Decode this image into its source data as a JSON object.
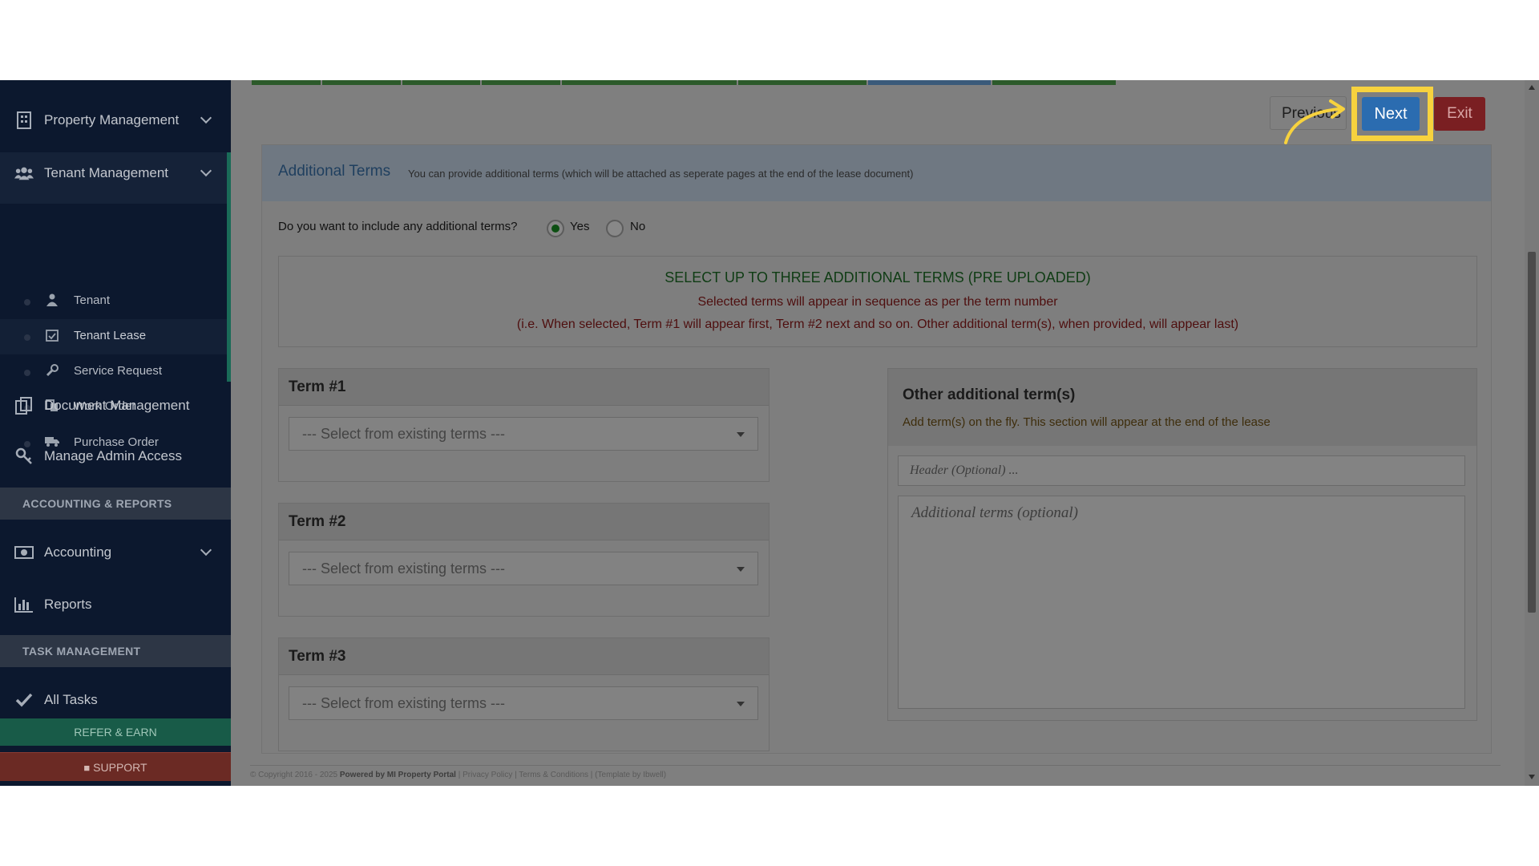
{
  "sidebar": {
    "items": [
      {
        "label": "Property Management",
        "icon": "building-icon"
      },
      {
        "label": "Tenant Management",
        "icon": "users-icon"
      },
      {
        "label": "Document Management",
        "icon": "documents-icon"
      },
      {
        "label": "Manage Admin Access",
        "icon": "key-icon"
      },
      {
        "label": "Accounting",
        "icon": "money-icon"
      },
      {
        "label": "Reports",
        "icon": "bar-chart-icon"
      },
      {
        "label": "All Tasks",
        "icon": "check-icon"
      }
    ],
    "sub_items": [
      {
        "label": "Tenant",
        "icon": "user-icon"
      },
      {
        "label": "Tenant Lease",
        "icon": "calendar-check-icon"
      },
      {
        "label": "Service Request",
        "icon": "wrench-icon"
      },
      {
        "label": "Work Order",
        "icon": "copy-icon"
      },
      {
        "label": "Purchase Order",
        "icon": "truck-icon"
      }
    ],
    "sections": {
      "accounting": "ACCOUNTING & REPORTS",
      "tasks": "TASK MANAGEMENT"
    },
    "refer_label": "REFER & EARN",
    "support_label": "SUPPORT"
  },
  "toolbar": {
    "prev_label": "Previous",
    "next_label": "Next",
    "exit_label": "Exit"
  },
  "panel": {
    "title": "Additional Terms",
    "subtitle": "You can provide additional terms (which will be attached as seperate pages at the end of the lease document)",
    "question": "Do you want to include any additional terms?",
    "yes_label": "Yes",
    "no_label": "No",
    "selected_option": "Yes"
  },
  "notice": {
    "line1": "SELECT UP TO THREE ADDITIONAL TERMS (PRE UPLOADED)",
    "line2": "Selected terms will appear in sequence as per the term number",
    "line3": "(i.e. When selected, Term #1 will appear first, Term #2 next and so on. Other additional term(s), when provided, will appear last)"
  },
  "terms": [
    {
      "label": "Term #1",
      "placeholder": "--- Select from existing terms ---"
    },
    {
      "label": "Term #2",
      "placeholder": "--- Select from existing terms ---"
    },
    {
      "label": "Term #3",
      "placeholder": "--- Select from existing terms ---"
    }
  ],
  "other": {
    "title": "Other additional term(s)",
    "subtitle": "Add term(s) on the fly. This section will appear at the end of the lease",
    "header_placeholder": "Header (Optional) ...",
    "text_placeholder": "Additional terms (optional)"
  },
  "footer": {
    "copyright": "© Copyright 2016 - 2025",
    "powered": "Powered by MI Property Portal",
    "links": "| Privacy Policy | Terms & Conditions |",
    "template": "(Template by Ibwell)"
  },
  "colors": {
    "accent": "#2b6cb0",
    "highlight": "#f7d23e",
    "exit": "#7a1f22",
    "sidebar": "#0c182e"
  }
}
